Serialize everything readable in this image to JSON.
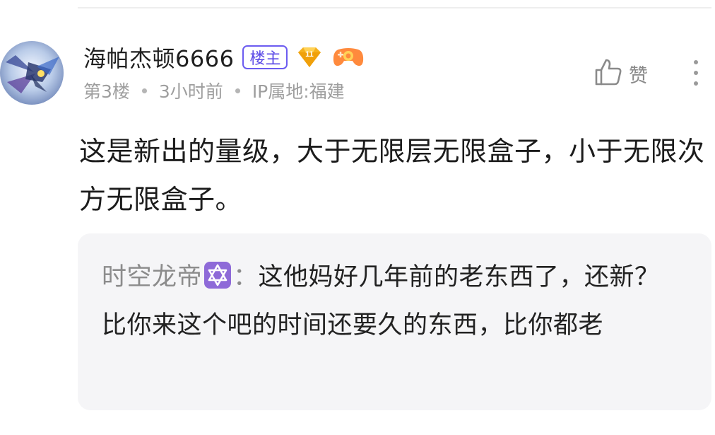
{
  "comment": {
    "author": {
      "username": "海帕杰顿6666",
      "owner_badge": "楼主",
      "level": "11",
      "level_icon": "diamond-level-icon",
      "extra_icon": "gamepad-icon"
    },
    "meta": {
      "floor": "第3楼",
      "time": "3小时前",
      "ip": "IP属地:福建"
    },
    "like_label": "赞",
    "body": "这是新出的量级，大于无限层无限盒子，小于无限次方无限盒子。",
    "quote": {
      "author": "时空龙帝",
      "author_emoji": "star-of-david-emoji",
      "colon": "：",
      "text": "这他妈好几年前的老东西了，还新？比你来这个吧的时间还要久的东西，比你都老"
    }
  },
  "colors": {
    "owner_badge": "#5a49e6",
    "level_badge": "#f5b01c",
    "meta_text": "#9e9e9e",
    "quote_bg": "#f5f5f7",
    "emoji_bg": "#8e6ad8"
  }
}
